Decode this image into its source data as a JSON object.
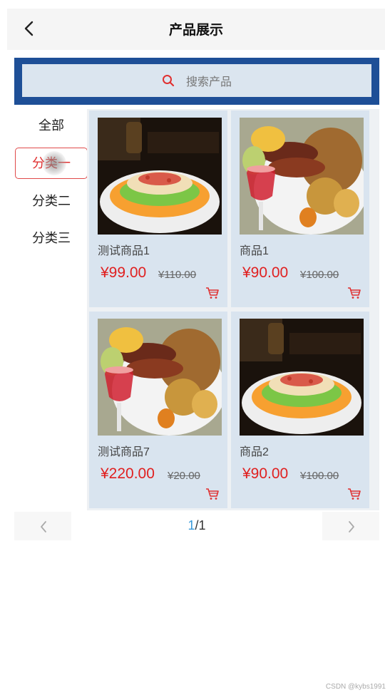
{
  "header": {
    "title": "产品展示"
  },
  "search": {
    "placeholder": "搜索产品"
  },
  "categories": [
    {
      "label": "全部",
      "active": false
    },
    {
      "label": "分类一",
      "active": true
    },
    {
      "label": "分类二",
      "active": false
    },
    {
      "label": "分类三",
      "active": false
    }
  ],
  "products": [
    {
      "name": "测试商品1",
      "price": "¥99.00",
      "original_price": "¥110.00",
      "image": "noodle-dish-photo"
    },
    {
      "name": "商品1",
      "price": "¥90.00",
      "original_price": "¥100.00",
      "image": "roast-platter-photo"
    },
    {
      "name": "测试商品7",
      "price": "¥220.00",
      "original_price": "¥20.00",
      "image": "roast-platter-photo"
    },
    {
      "name": "商品2",
      "price": "¥90.00",
      "original_price": "¥100.00",
      "image": "noodle-dish-photo"
    }
  ],
  "pagination": {
    "current": "1",
    "separator": "/",
    "total": "1"
  },
  "watermark": "CSDN @kybs1991",
  "colors": {
    "accent_red": "#e02020",
    "search_border": "#1e4f97",
    "card_bg": "#d9e4ef",
    "page_current": "#3a9ad9"
  }
}
